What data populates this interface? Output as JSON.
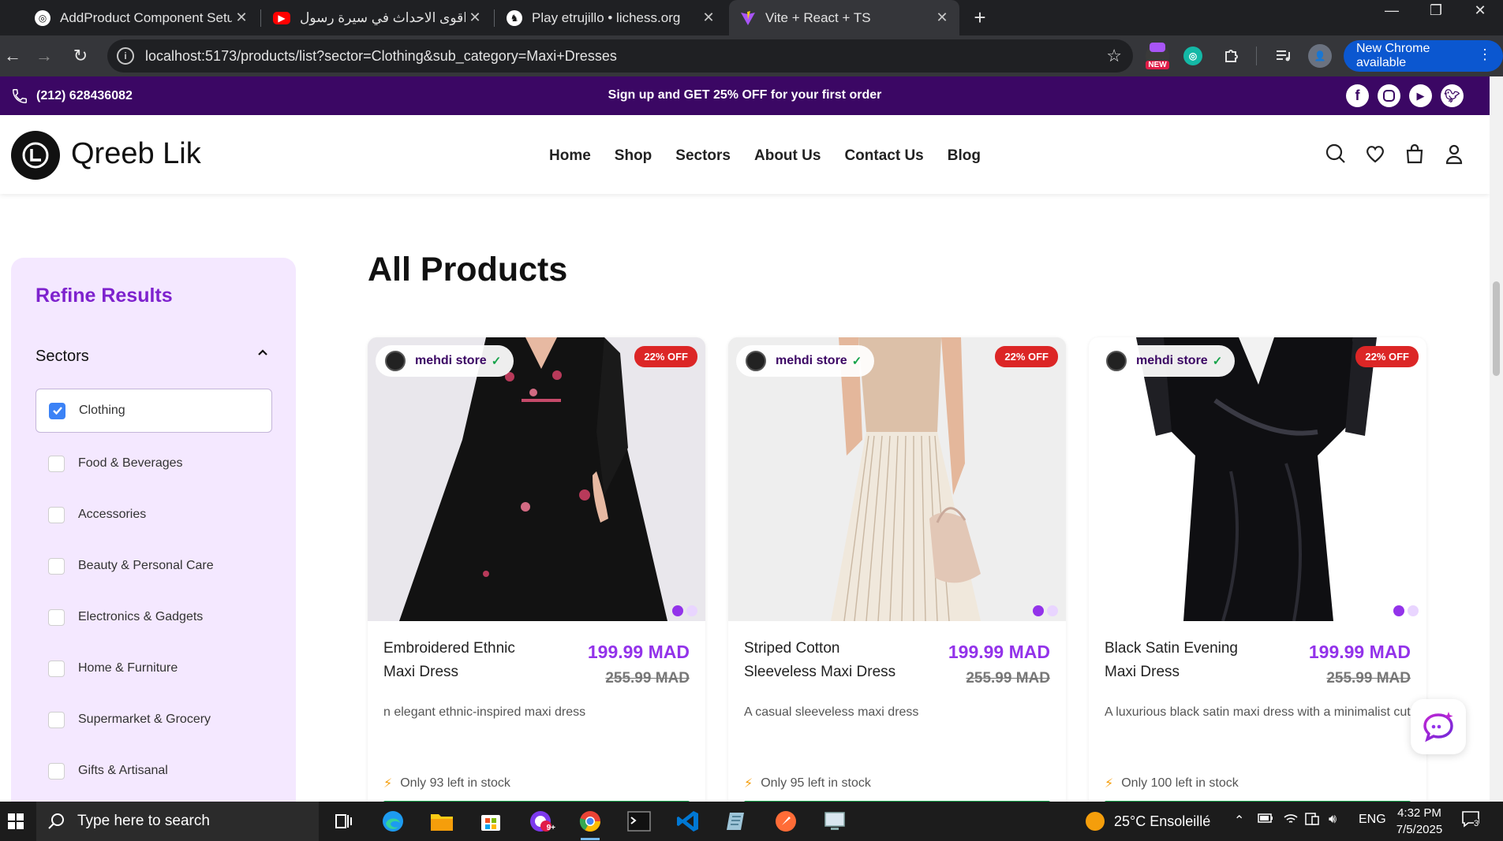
{
  "browser": {
    "tabs": [
      {
        "title": "AddProduct Component Setup",
        "icon": "openai-icon",
        "active": false
      },
      {
        "title": "من اقوى الاحداث في سيرة رسول",
        "icon": "youtube-icon",
        "active": false
      },
      {
        "title": "Play etrujillo • lichess.org",
        "icon": "lichess-icon",
        "active": false
      },
      {
        "title": "Vite + React + TS",
        "icon": "vite-icon",
        "active": true
      }
    ],
    "url": "localhost:5173/products/list?sector=Clothing&sub_category=Maxi+Dresses",
    "extension_badge": "NEW",
    "new_chrome_label": "New Chrome available"
  },
  "promo_bar": {
    "phone": "(212) 628436082",
    "promo_prefix": "Sign up and ",
    "promo_highlight": "GET 25% OFF",
    "promo_suffix": " for your first order",
    "socials": [
      "facebook-icon",
      "instagram-icon",
      "youtube-icon",
      "twitter-icon"
    ]
  },
  "header": {
    "brand": "Qreeb Lik",
    "nav": [
      "Home",
      "Shop",
      "Sectors",
      "About Us",
      "Contact Us",
      "Blog"
    ]
  },
  "sidebar": {
    "title": "Refine Results",
    "section_title": "Sectors",
    "options": [
      {
        "label": "Clothing",
        "checked": true
      },
      {
        "label": "Food & Beverages",
        "checked": false
      },
      {
        "label": "Accessories",
        "checked": false
      },
      {
        "label": "Beauty & Personal Care",
        "checked": false
      },
      {
        "label": "Electronics & Gadgets",
        "checked": false
      },
      {
        "label": "Home & Furniture",
        "checked": false
      },
      {
        "label": "Supermarket & Grocery",
        "checked": false
      },
      {
        "label": "Gifts & Artisanal",
        "checked": false
      }
    ]
  },
  "main": {
    "title": "All Products",
    "products": [
      {
        "store": "mehdi store",
        "discount": "22% OFF",
        "name": "Embroidered Ethnic Maxi Dress",
        "price": "199.99 MAD",
        "old_price": "255.99 MAD",
        "description": "n elegant ethnic-inspired maxi dress",
        "stock": "Only 93 left in stock"
      },
      {
        "store": "mehdi store",
        "discount": "22% OFF",
        "name": "Striped Cotton Sleeveless Maxi Dress",
        "price": "199.99 MAD",
        "old_price": "255.99 MAD",
        "description": "A casual sleeveless maxi dress",
        "stock": "Only 95 left in stock"
      },
      {
        "store": "mehdi store",
        "discount": "22% OFF",
        "name": "Black Satin Evening Maxi Dress",
        "price": "199.99 MAD",
        "old_price": "255.99 MAD",
        "description": "A luxurious black satin maxi dress with a minimalist cut",
        "stock": "Only 100 left in stock"
      }
    ]
  },
  "taskbar": {
    "search_placeholder": "Type here to search",
    "weather": "25°C Ensoleillé",
    "language": "ENG",
    "time": "4:32 PM",
    "date": "7/5/2025",
    "notification_count": "3",
    "mail_badge": "9+"
  },
  "colors": {
    "brand_purple": "#7e22ce",
    "promo_bg": "#3b0764",
    "price_purple": "#9333ea",
    "badge_red": "#dc2626"
  }
}
